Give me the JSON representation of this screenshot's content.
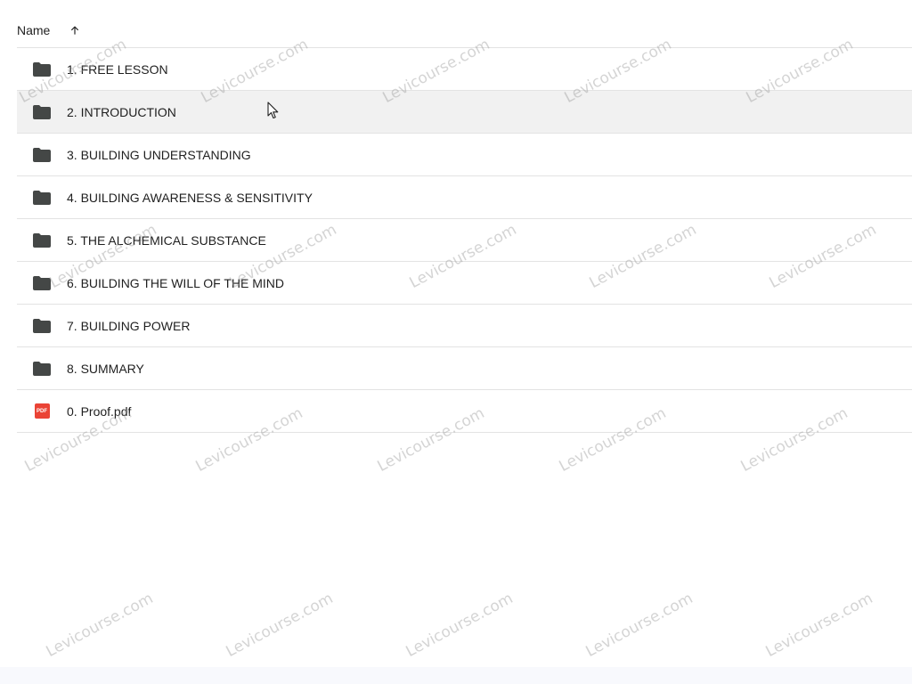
{
  "header": {
    "name_label": "Name",
    "sort_icon": "arrow-up-icon"
  },
  "files": [
    {
      "label": "1. FREE LESSON",
      "type": "folder"
    },
    {
      "label": "2. INTRODUCTION",
      "type": "folder"
    },
    {
      "label": "3. BUILDING UNDERSTANDING",
      "type": "folder"
    },
    {
      "label": "4. BUILDING AWARENESS & SENSITIVITY",
      "type": "folder"
    },
    {
      "label": "5. THE ALCHEMICAL SUBSTANCE",
      "type": "folder"
    },
    {
      "label": "6. BUILDING THE WILL OF THE MIND",
      "type": "folder"
    },
    {
      "label": "7. BUILDING POWER",
      "type": "folder"
    },
    {
      "label": "8. SUMMARY",
      "type": "folder"
    },
    {
      "label": "0. Proof.pdf",
      "type": "pdf",
      "badge": "PDF"
    }
  ],
  "watermark_text": "Levicourse.com",
  "colors": {
    "folder": "#444746",
    "pdf": "#ea4335",
    "hover_row": "#f1f1f1",
    "divider": "#e3e3e3"
  }
}
